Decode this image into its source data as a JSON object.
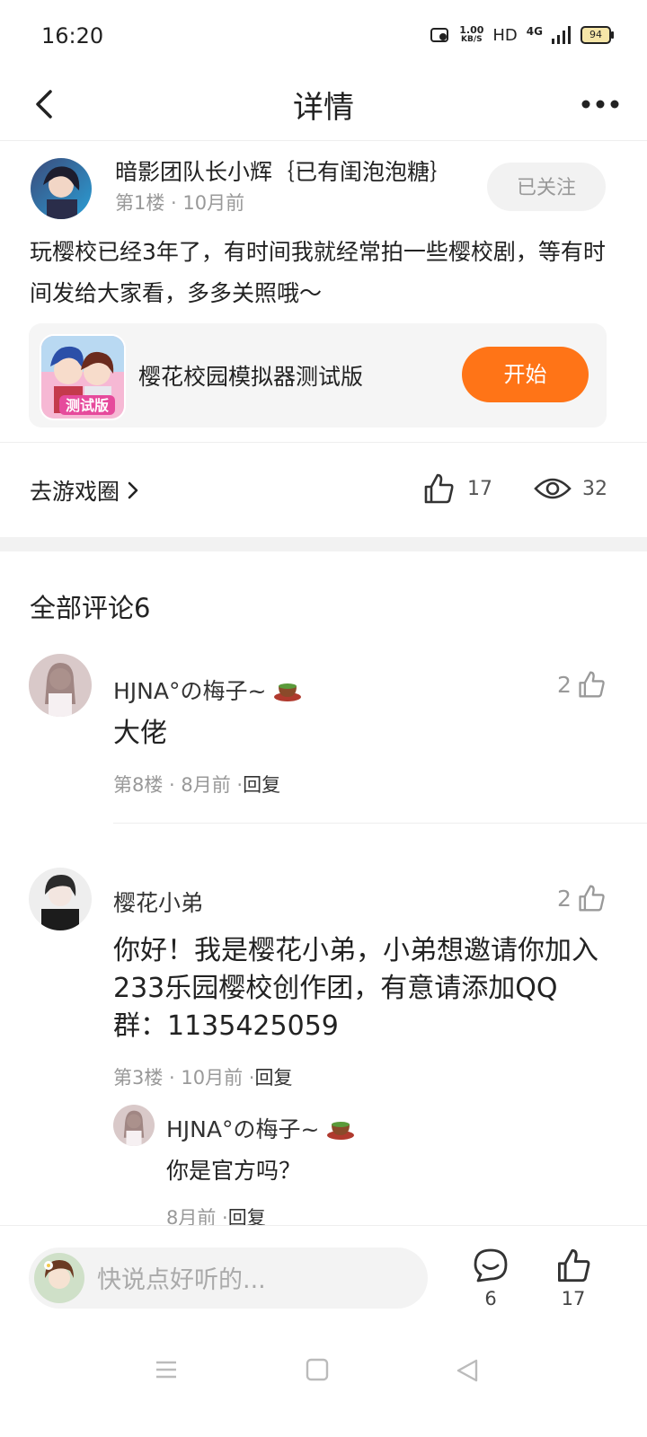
{
  "status_bar": {
    "time": "16:20",
    "net_speed_top": "1.00",
    "net_speed_bottom": "KB/S",
    "hd": "HD",
    "network": "4G",
    "battery": "94"
  },
  "header": {
    "title": "详情"
  },
  "post": {
    "author": "暗影团队长小辉｛已有闺泡泡糖｝",
    "meta": "第1楼 · 10月前",
    "follow_label": "已关注",
    "body": "玩樱校已经3年了，有时间我就经常拍一些樱校剧，等有时间发给大家看，多多关照哦～",
    "game": {
      "name": "樱花校园模拟器测试版",
      "icon_badge": "测试版",
      "start_label": "开始"
    },
    "goto_label": "去游戏圈",
    "likes": "17",
    "views": "32"
  },
  "comments_section": {
    "title": "全部评论6",
    "comments": [
      {
        "name": "HJNA°の梅子~",
        "likes": "2",
        "text": "大佬",
        "meta": "第8楼 · 8月前 ·",
        "reply_label": "回复"
      },
      {
        "name": "樱花小弟",
        "likes": "2",
        "text": "你好！我是樱花小弟，小弟想邀请你加入233乐园樱校创作团，有意请添加QQ群：1135425059",
        "meta": "第3楼 · 10月前 ·",
        "reply_label": "回复",
        "reply": {
          "name": "HJNA°の梅子~",
          "text": "你是官方吗？",
          "meta": "8月前 ·",
          "reply_label": "回复"
        }
      }
    ]
  },
  "bottom_bar": {
    "input_placeholder": "快说点好听的...",
    "comment_count": "6",
    "like_count": "17"
  },
  "colors": {
    "accent": "#ff7417",
    "muted_text": "#999999",
    "divider": "#eeeeee"
  },
  "icons": [
    "back-arrow-icon",
    "more-dots-icon",
    "thumb-up-icon",
    "eye-icon",
    "chevron-right-icon",
    "tea-cup-icon",
    "chat-bubble-icon",
    "menu-icon",
    "home-square-icon",
    "back-triangle-icon"
  ]
}
